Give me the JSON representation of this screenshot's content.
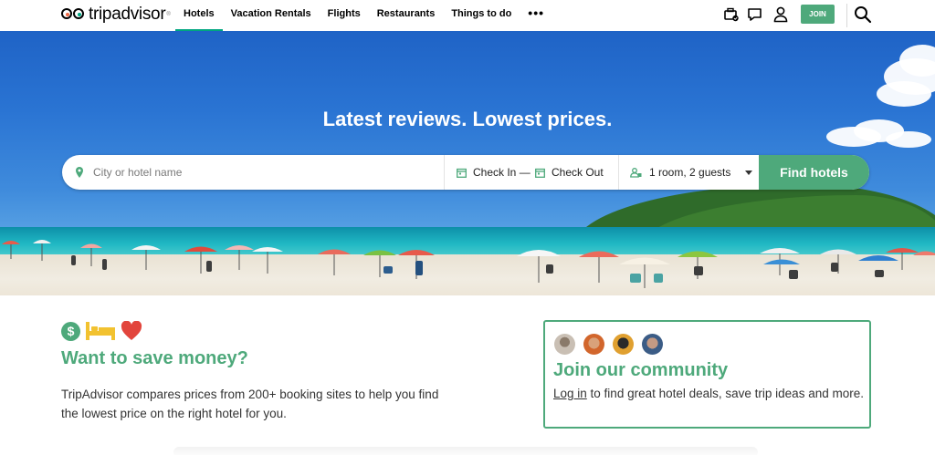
{
  "brand": {
    "name": "tripadvisor",
    "reg": "®"
  },
  "nav": {
    "tabs": [
      {
        "label": "Hotels",
        "active": true
      },
      {
        "label": "Vacation Rentals"
      },
      {
        "label": "Flights"
      },
      {
        "label": "Restaurants"
      },
      {
        "label": "Things to do"
      }
    ],
    "more_label": "•••",
    "join_label": "JOIN",
    "icons": [
      "trips-icon",
      "messages-icon",
      "profile-icon",
      "search-icon"
    ]
  },
  "hero": {
    "headline": "Latest reviews. Lowest prices.",
    "search": {
      "placeholder": "City or hotel name",
      "check_in": "Check In —",
      "check_out": "Check Out",
      "guests": "1 room, 2 guests",
      "button": "Find hotels"
    }
  },
  "save": {
    "title": "Want to save money?",
    "text": "TripAdvisor compares prices from 200+ booking sites to help you find the lowest price on the right hotel for you."
  },
  "community": {
    "title": "Join our community",
    "login_label": "Log in",
    "text_after": " to find great hotel deals, save trip ideas and more."
  },
  "colors": {
    "accent": "#4ea97b",
    "heart": "#e2453c",
    "bed": "#f2c230",
    "sky": "#2a74d3"
  }
}
